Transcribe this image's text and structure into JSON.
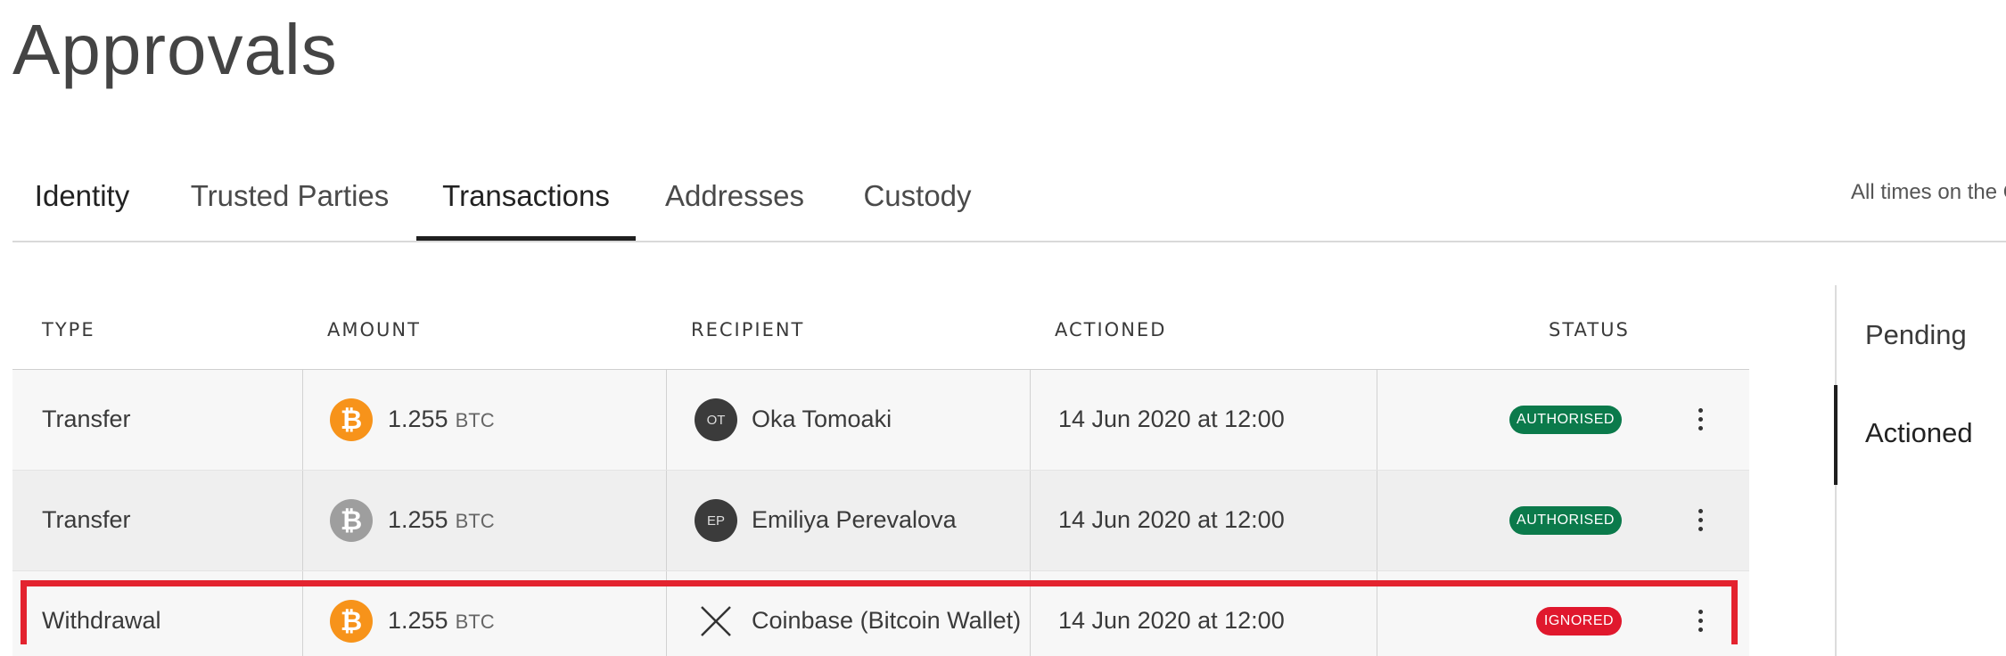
{
  "page": {
    "title": "Approvals"
  },
  "tabs": [
    {
      "label": "Identity"
    },
    {
      "label": "Trusted Parties"
    },
    {
      "label": "Transactions"
    },
    {
      "label": "Addresses"
    },
    {
      "label": "Custody"
    }
  ],
  "timezone_note": "All times on the Q",
  "table": {
    "headers": {
      "type": "TYPE",
      "amount": "AMOUNT",
      "recipient": "RECIPIENT",
      "actioned": "ACTIONED",
      "status": "STATUS"
    },
    "rows": [
      {
        "type": "Transfer",
        "amount": "1.255",
        "unit": "BTC",
        "coin_icon": "bitcoin-icon",
        "recipient_initials": "OT",
        "recipient": "Oka Tomoaki",
        "actioned": "14 Jun 2020 at 12:00",
        "status": "AUTHORISED"
      },
      {
        "type": "Transfer",
        "amount": "1.255",
        "unit": "BTC",
        "coin_icon": "bitcoin-icon",
        "recipient_initials": "EP",
        "recipient": "Emiliya Perevalova",
        "actioned": "14 Jun 2020 at 12:00",
        "status": "AUTHORISED"
      },
      {
        "type": "Withdrawal",
        "amount": "1.255",
        "unit": "BTC",
        "coin_icon": "bitcoin-icon",
        "recipient_icon": "close-x-icon",
        "recipient": "Coinbase (Bitcoin Wallet)",
        "actioned": "14 Jun 2020 at 12:00",
        "status": "IGNORED"
      }
    ]
  },
  "side_nav": [
    {
      "label": "Pending"
    },
    {
      "label": "Actioned"
    }
  ],
  "colors": {
    "authorised": "#0b7a4b",
    "ignored": "#e0182d",
    "bitcoin": "#f7931a",
    "highlight": "#e3232f"
  }
}
